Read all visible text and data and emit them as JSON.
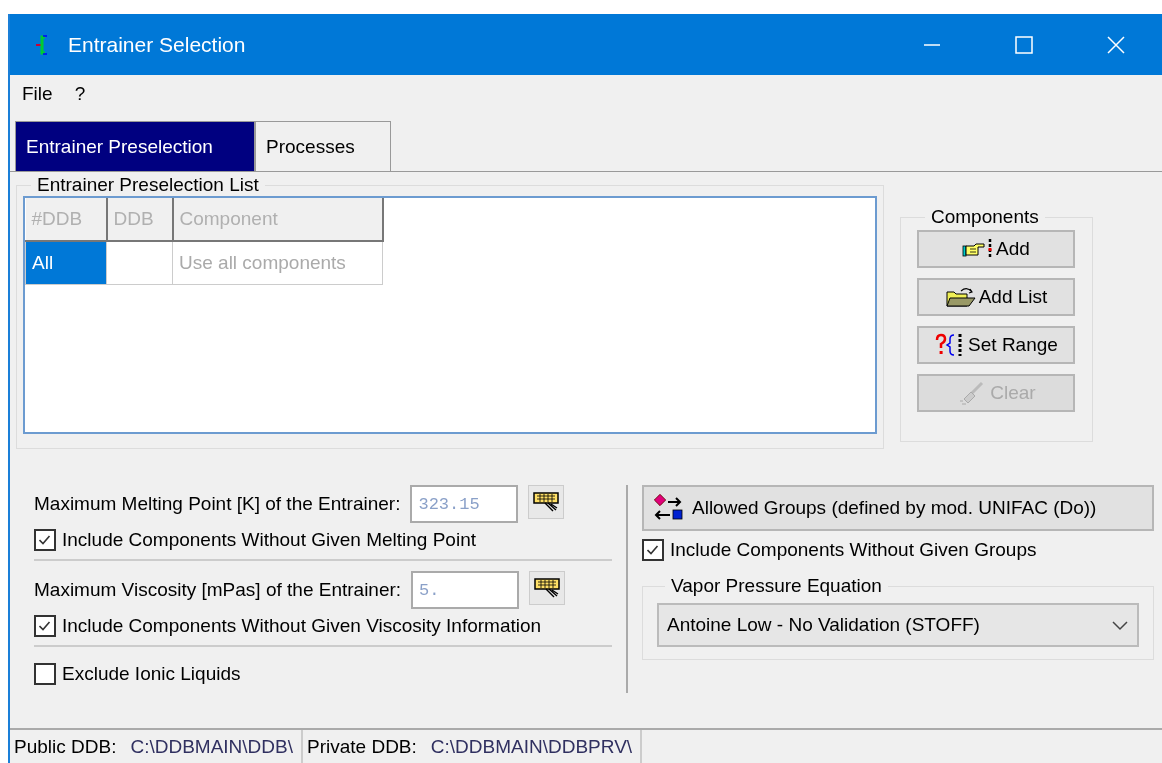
{
  "window": {
    "title": "Entrainer Selection"
  },
  "menu": [
    {
      "label": "File"
    },
    {
      "label": "?"
    }
  ],
  "tabs": [
    {
      "label": "Entrainer Preselection",
      "selected": true
    },
    {
      "label": "Processes",
      "selected": false
    }
  ],
  "preselection_list": {
    "title": "Entrainer Preselection List",
    "columns": [
      "#DDB",
      "DDB",
      "Component"
    ],
    "rows": [
      {
        "ddb_no": "All",
        "component": "Use all components",
        "selected": true
      }
    ]
  },
  "components": {
    "title": "Components",
    "buttons": [
      {
        "label": "Add",
        "kind": "hand",
        "disabled": false
      },
      {
        "label": "Add List",
        "kind": "folder",
        "disabled": false
      },
      {
        "label": "Set Range",
        "kind": "range",
        "disabled": false
      },
      {
        "label": "Clear",
        "kind": "broom",
        "disabled": true
      }
    ]
  },
  "limits": [
    {
      "label": "Maximum Melting Point [K] of the Entrainer:",
      "value": "323.15",
      "include_label": "Include Components Without Given Melting Point",
      "include_checked": true
    },
    {
      "label": "Maximum Viscosity [mPas] of the Entrainer:",
      "value": "5.",
      "include_label": "Include Components Without Given Viscosity Information",
      "include_checked": true
    }
  ],
  "exclude_ionic": {
    "label": "Exclude Ionic Liquids",
    "checked": false
  },
  "groups": {
    "button": "Allowed Groups (defined by mod. UNIFAC (Do))",
    "include_label": "Include Components Without Given Groups",
    "include_checked": true
  },
  "vapor_pressure": {
    "title": "Vapor Pressure Equation",
    "value": "Antoine Low - No Validation (STOFF)"
  },
  "status_bar": [
    {
      "label": "Public DDB:",
      "path": "C:\\DDBMAIN\\DDB\\"
    },
    {
      "label": "Private DDB:",
      "path": "C:\\DDBMAIN\\DDBPRV\\"
    }
  ]
}
